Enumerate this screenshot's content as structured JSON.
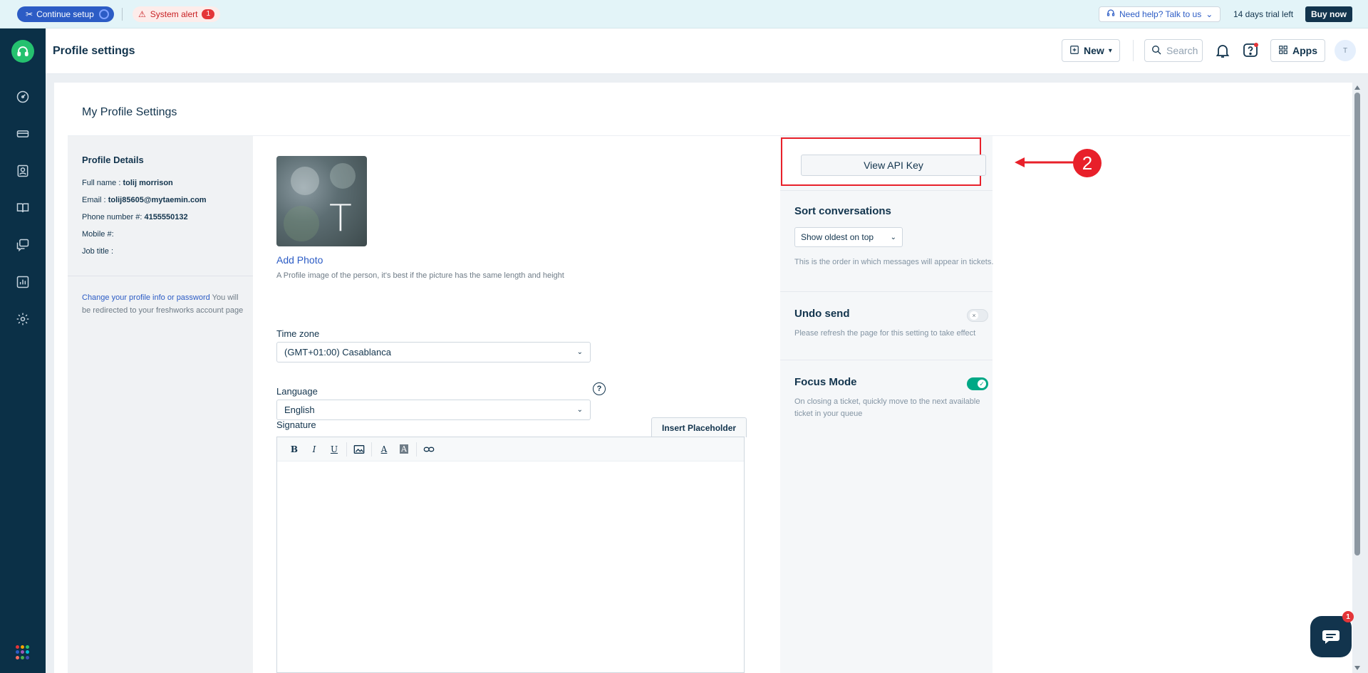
{
  "banner": {
    "setup_label": "Continue setup",
    "alert_label": "System alert",
    "alert_count": "1",
    "help_label": "Need help? Talk to us",
    "trial_text": "14 days trial left",
    "buy_label": "Buy now"
  },
  "sidebar": {
    "items": [
      "dashboard-icon",
      "tickets-icon",
      "contacts-icon",
      "knowledge-base-icon",
      "chat-icon",
      "reports-icon",
      "settings-icon"
    ]
  },
  "header": {
    "title": "Profile settings",
    "new_label": "New",
    "search_placeholder": "Search",
    "apps_label": "Apps",
    "avatar_initial": "T"
  },
  "main": {
    "section_title": "My Profile Settings"
  },
  "profile_details": {
    "title": "Profile Details",
    "full_name_label": "Full name :",
    "full_name": "tolij morrison",
    "email_label": "Email :",
    "email": "tolij85605@mytaemin.com",
    "phone_label": "Phone number #:",
    "phone": "4155550132",
    "mobile_label": "Mobile #:",
    "job_label": "Job title :",
    "change_link": "Change your profile info or password",
    "change_note": " You will be redirected to your freshworks account page"
  },
  "form": {
    "photo_initial": "T",
    "add_photo": "Add Photo",
    "photo_hint": "A Profile image of the person, it's best if the picture has the same length and height",
    "timezone_label": "Time zone",
    "timezone_value": "(GMT+01:00) Casablanca",
    "language_label": "Language",
    "language_value": "English",
    "signature_label": "Signature",
    "insert_placeholder": "Insert Placeholder"
  },
  "right": {
    "api_button": "View API Key",
    "sort_title": "Sort conversations",
    "sort_value": "Show oldest on top",
    "sort_desc": "This is the order in which messages will appear in tickets.",
    "undo_title": "Undo send",
    "undo_desc": "Please refresh the page for this setting to take effect",
    "focus_title": "Focus Mode",
    "focus_desc": "On closing a ticket, quickly move to the next available ticket in your queue"
  },
  "annotation": {
    "number": "2",
    "color": "#e8202a"
  },
  "chat": {
    "badge": "1"
  },
  "colors": {
    "sidebar": "#0b3047",
    "brand_green": "#25c16f",
    "link_blue": "#2c5cc5",
    "toggle_on": "#00a886"
  }
}
